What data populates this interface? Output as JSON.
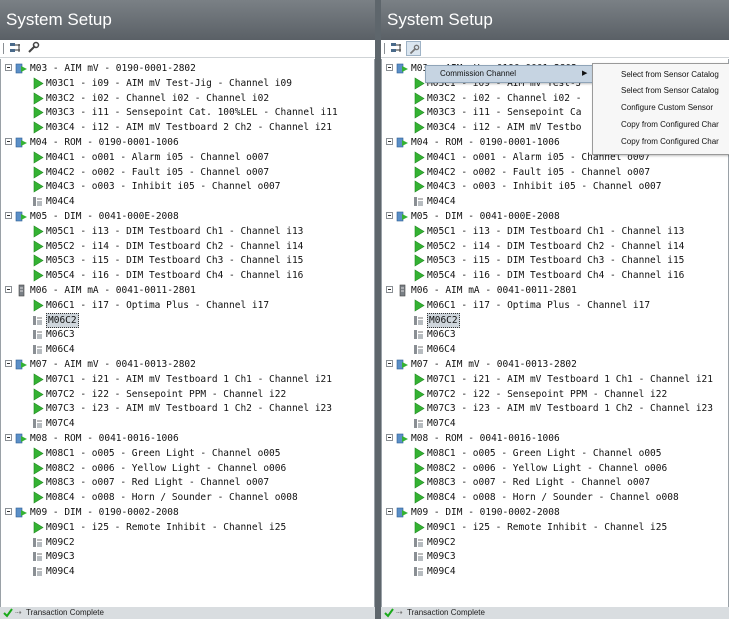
{
  "colors": {
    "title_bar": "#6a7075",
    "play_green": "#34b233",
    "check_green": "#1aaa1a",
    "selected_bg": "#cfd6dc",
    "menu_highlight": "#c6d4e2"
  },
  "icons": {
    "tree_play": "play-triangle-icon",
    "unassigned_channel": "sensor-channel-icon",
    "module": "module-card-icon",
    "toolbar_a": "sensor-tree-icon",
    "toolbar_b": "wrench-icon",
    "status": "check-mark-icon"
  },
  "panels": [
    {
      "title": "System Setup",
      "status": {
        "text": "Transaction Complete"
      },
      "tree": [
        {
          "type": "module",
          "label": "M03 - AIM mV - 0190-0001-2802"
        },
        {
          "type": "ch",
          "label": "M03C1 - i09 - AIM mV Test-Jig - Channel i09"
        },
        {
          "type": "ch",
          "label": "M03C2 - i02 - Channel i02 - Channel i02"
        },
        {
          "type": "ch",
          "label": "M03C3 - i11 - Sensepoint Cat. 100%LEL - Channel i11"
        },
        {
          "type": "ch",
          "label": "M03C4 - i12 - AIM mV Testboard 2 Ch2 - Channel i21"
        },
        {
          "type": "module",
          "label": "M04 - ROM - 0190-0001-1006"
        },
        {
          "type": "ch",
          "label": "M04C1 - o001 - Alarm i05 - Channel o007"
        },
        {
          "type": "ch",
          "label": "M04C2 - o002 - Fault i05 - Channel o007"
        },
        {
          "type": "ch",
          "label": "M04C3 - o003 - Inhibit i05 - Channel o007"
        },
        {
          "type": "un",
          "label": "M04C4"
        },
        {
          "type": "module",
          "label": "M05 - DIM - 0041-000E-2008"
        },
        {
          "type": "ch",
          "label": "M05C1 - i13 - DIM Testboard Ch1 - Channel i13"
        },
        {
          "type": "ch",
          "label": "M05C2 - i14 - DIM Testboard Ch2 - Channel i14"
        },
        {
          "type": "ch",
          "label": "M05C3 - i15 - DIM Testboard Ch3 - Channel i15"
        },
        {
          "type": "ch",
          "label": "M05C4 - i16 - DIM Testboard Ch4 - Channel i16"
        },
        {
          "type": "module2",
          "label": "M06 - AIM mA - 0041-0011-2801"
        },
        {
          "type": "ch",
          "label": "M06C1 - i17 - Optima Plus - Channel i17"
        },
        {
          "type": "un",
          "label": "M06C2",
          "selected": true
        },
        {
          "type": "un",
          "label": "M06C3"
        },
        {
          "type": "un",
          "label": "M06C4"
        },
        {
          "type": "module",
          "label": "M07 - AIM mV - 0041-0013-2802"
        },
        {
          "type": "ch",
          "label": "M07C1 - i21 - AIM mV Testboard 1 Ch1 - Channel i21"
        },
        {
          "type": "ch",
          "label": "M07C2 - i22 - Sensepoint PPM - Channel i22"
        },
        {
          "type": "ch",
          "label": "M07C3 - i23 - AIM mV Testboard 1 Ch2 - Channel i23"
        },
        {
          "type": "un",
          "label": "M07C4"
        },
        {
          "type": "module",
          "label": "M08 - ROM - 0041-0016-1006"
        },
        {
          "type": "ch",
          "label": "M08C1 - o005 - Green Light - Channel o005"
        },
        {
          "type": "ch",
          "label": "M08C2 - o006 - Yellow Light - Channel o006"
        },
        {
          "type": "ch",
          "label": "M08C3 - o007 - Red Light - Channel o007"
        },
        {
          "type": "ch",
          "label": "M08C4 - o008 - Horn / Sounder - Channel o008"
        },
        {
          "type": "module",
          "label": "M09 - DIM - 0190-0002-2008"
        },
        {
          "type": "ch",
          "label": "M09C1 - i25 - Remote Inhibit - Channel i25"
        },
        {
          "type": "un",
          "label": "M09C2"
        },
        {
          "type": "un",
          "label": "M09C3"
        },
        {
          "type": "un",
          "label": "M09C4"
        }
      ]
    },
    {
      "title": "System Setup",
      "status": {
        "text": "Transaction Complete"
      },
      "tree": [
        {
          "type": "module",
          "label": "M03 - AIM mV - 0190-0001-2802"
        },
        {
          "type": "ch",
          "label": "M03C1 - i09 - AIM mV Test-J"
        },
        {
          "type": "ch",
          "label": "M03C2 - i02 - Channel i02 -"
        },
        {
          "type": "ch",
          "label": "M03C3 - i11 - Sensepoint Ca"
        },
        {
          "type": "ch",
          "label": "M03C4 - i12 - AIM mV Testbo"
        },
        {
          "type": "module",
          "label": "M04 - ROM - 0190-0001-1006"
        },
        {
          "type": "ch",
          "label": "M04C1 - o001 - Alarm i05 - Channel o007"
        },
        {
          "type": "ch",
          "label": "M04C2 - o002 - Fault i05 - Channel o007"
        },
        {
          "type": "ch",
          "label": "M04C3 - o003 - Inhibit i05 - Channel o007"
        },
        {
          "type": "un",
          "label": "M04C4"
        },
        {
          "type": "module",
          "label": "M05 - DIM - 0041-000E-2008"
        },
        {
          "type": "ch",
          "label": "M05C1 - i13 - DIM Testboard Ch1 - Channel i13"
        },
        {
          "type": "ch",
          "label": "M05C2 - i14 - DIM Testboard Ch2 - Channel i14"
        },
        {
          "type": "ch",
          "label": "M05C3 - i15 - DIM Testboard Ch3 - Channel i15"
        },
        {
          "type": "ch",
          "label": "M05C4 - i16 - DIM Testboard Ch4 - Channel i16"
        },
        {
          "type": "module2",
          "label": "M06 - AIM mA - 0041-0011-2801"
        },
        {
          "type": "ch",
          "label": "M06C1 - i17 - Optima Plus - Channel i17"
        },
        {
          "type": "un",
          "label": "M06C2",
          "selected": true
        },
        {
          "type": "un",
          "label": "M06C3"
        },
        {
          "type": "un",
          "label": "M06C4"
        },
        {
          "type": "module",
          "label": "M07 - AIM mV - 0041-0013-2802"
        },
        {
          "type": "ch",
          "label": "M07C1 - i21 - AIM mV Testboard 1 Ch1 - Channel i21"
        },
        {
          "type": "ch",
          "label": "M07C2 - i22 - Sensepoint PPM - Channel i22"
        },
        {
          "type": "ch",
          "label": "M07C3 - i23 - AIM mV Testboard 1 Ch2 - Channel i23"
        },
        {
          "type": "un",
          "label": "M07C4"
        },
        {
          "type": "module",
          "label": "M08 - ROM - 0041-0016-1006"
        },
        {
          "type": "ch",
          "label": "M08C1 - o005 - Green Light - Channel o005"
        },
        {
          "type": "ch",
          "label": "M08C2 - o006 - Yellow Light - Channel o006"
        },
        {
          "type": "ch",
          "label": "M08C3 - o007 - Red Light - Channel o007"
        },
        {
          "type": "ch",
          "label": "M08C4 - o008 - Horn / Sounder - Channel o008"
        },
        {
          "type": "module",
          "label": "M09 - DIM - 0190-0002-2008"
        },
        {
          "type": "ch",
          "label": "M09C1 - i25 - Remote Inhibit - Channel i25"
        },
        {
          "type": "un",
          "label": "M09C2"
        },
        {
          "type": "un",
          "label": "M09C3"
        },
        {
          "type": "un",
          "label": "M09C4"
        }
      ]
    }
  ],
  "context_menu": {
    "item": "Commission Channel",
    "submenu": [
      "Select from Sensor Catalog",
      "Select from Sensor Catalog",
      "Configure Custom Sensor",
      "Copy from Configured Char",
      "Copy from Configured Char"
    ]
  }
}
